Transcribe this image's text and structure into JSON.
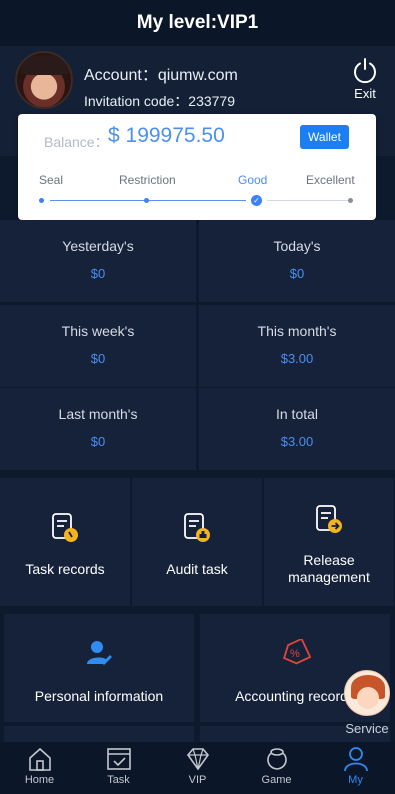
{
  "header": {
    "title": "My level:VIP1"
  },
  "profile": {
    "account_text": "Account：qiumw.com",
    "invite_text": "Invitation code：233779",
    "exit_label": "Exit"
  },
  "balance": {
    "label": "Balance：",
    "value": "$ 199975.50",
    "wallet_label": "Wallet",
    "levels": [
      "Seal",
      "Restriction",
      "Good",
      "Excellent"
    ],
    "current_level": "Good"
  },
  "stats": [
    {
      "label": "Yesterday's",
      "value": "$0"
    },
    {
      "label": "Today's",
      "value": "$0"
    },
    {
      "label": "This week's",
      "value": "$0"
    },
    {
      "label": "This month's",
      "value": "$3.00"
    },
    {
      "label": "Last month's",
      "value": "$0"
    },
    {
      "label": "In total",
      "value": "$3.00"
    }
  ],
  "tiles": [
    {
      "label": "Task records",
      "icon": "task-records-icon"
    },
    {
      "label": "Audit task",
      "icon": "audit-task-icon"
    },
    {
      "label": "Release management",
      "icon": "release-management-icon"
    }
  ],
  "big_tiles": [
    {
      "label": "Personal information",
      "icon": "user-edit-icon"
    },
    {
      "label": "Accounting records",
      "icon": "tag-percent-icon"
    }
  ],
  "service": {
    "label": "Service"
  },
  "tabbar": [
    {
      "label": "Home",
      "icon": "home-icon"
    },
    {
      "label": "Task",
      "icon": "task-icon"
    },
    {
      "label": "VIP",
      "icon": "diamond-icon"
    },
    {
      "label": "Game",
      "icon": "game-icon"
    },
    {
      "label": "My",
      "icon": "user-icon"
    }
  ],
  "colors": {
    "accent": "#4b8ff0",
    "background": "#0d1a2e",
    "panel": "#15223a",
    "wallet_button": "#1b7ef2",
    "accounting_icon": "#e0453a"
  }
}
